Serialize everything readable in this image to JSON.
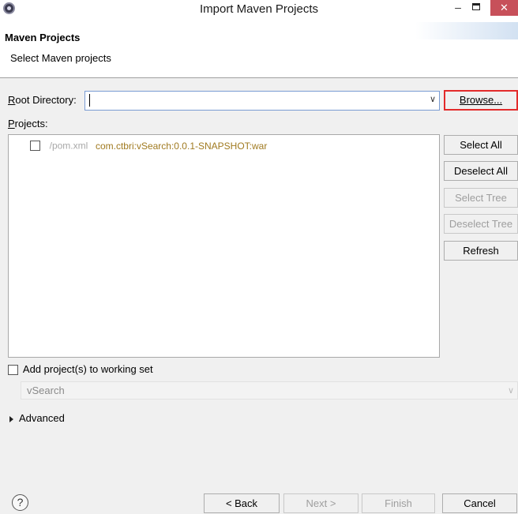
{
  "window": {
    "title": "Import Maven Projects",
    "minimize_glyph": "–",
    "close_glyph": "✕"
  },
  "header": {
    "title": "Maven Projects",
    "description": "Select Maven projects"
  },
  "root_directory": {
    "label": "Root Directory:",
    "value": "",
    "browse_label": "Browse..."
  },
  "projects": {
    "label": "Projects:",
    "items": [
      {
        "path": "/pom.xml",
        "coordinates": "com.ctbri:vSearch:0.0.1-SNAPSHOT:war",
        "checked": false
      }
    ]
  },
  "side_buttons": {
    "select_all": "Select All",
    "deselect_all": "Deselect All",
    "select_tree": "Select Tree",
    "deselect_tree": "Deselect Tree",
    "refresh": "Refresh"
  },
  "working_set": {
    "checkbox_label": "Add project(s) to working set",
    "checked": false,
    "value": "vSearch"
  },
  "advanced": {
    "label": "Advanced"
  },
  "footer": {
    "help_glyph": "?",
    "back": "< Back",
    "next": "Next >",
    "finish": "Finish",
    "cancel": "Cancel"
  },
  "colors": {
    "browse_highlight": "#e32b2b",
    "close_button": "#c7505a",
    "coordinates_text": "#a07a20"
  }
}
